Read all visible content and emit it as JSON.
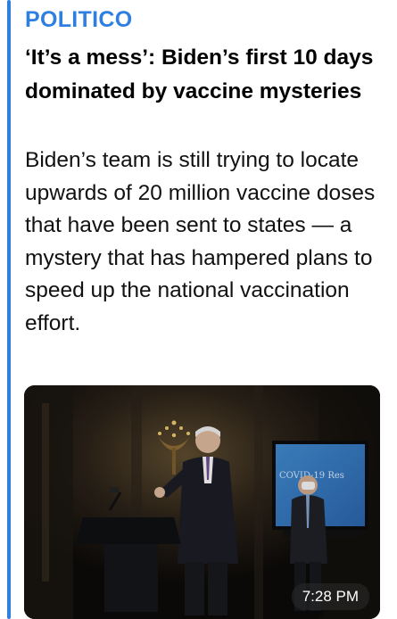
{
  "message": {
    "source": "POLITICO",
    "headline": "‘It’s a mess’: Biden’s first 10 days dominated by vaccine mysteries",
    "summary": "Biden’s team is still trying to locate upwards of 20 million vaccine doses that have been sent to states — a mystery that has hampered plans to speed up the national vaccination effort.",
    "timestamp": "7:28 PM",
    "screen_text": "COVID-19 Res",
    "accent_color": "#2f7fe0"
  }
}
